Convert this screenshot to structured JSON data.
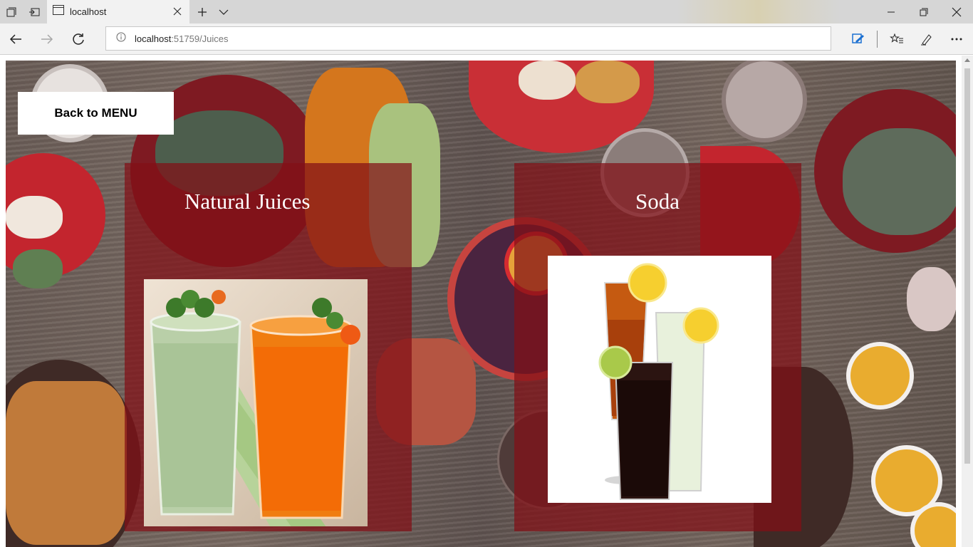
{
  "browser": {
    "tab_title": "localhost",
    "url_host": "localhost",
    "url_path": ":51759/Juices"
  },
  "page": {
    "back_button": "Back to MENU",
    "categories": [
      {
        "title": "Natural Juices",
        "image": "juice-glasses"
      },
      {
        "title": "Soda",
        "image": "soda-glasses"
      }
    ]
  },
  "icons": {
    "tab_actions": "tab-actions-icon",
    "tabs_aside": "tabs-aside-icon",
    "page": "page-icon",
    "close": "close-icon",
    "new_tab": "plus-icon",
    "tab_list": "chevron-down-icon",
    "minimize": "minimize-icon",
    "restore": "restore-icon",
    "window_close": "close-icon",
    "back": "arrow-left-icon",
    "forward": "arrow-right-icon",
    "refresh": "refresh-icon",
    "info": "info-icon",
    "reading": "reading-view-icon",
    "favorites": "favorites-icon",
    "notes": "pen-icon",
    "more": "more-icon"
  }
}
